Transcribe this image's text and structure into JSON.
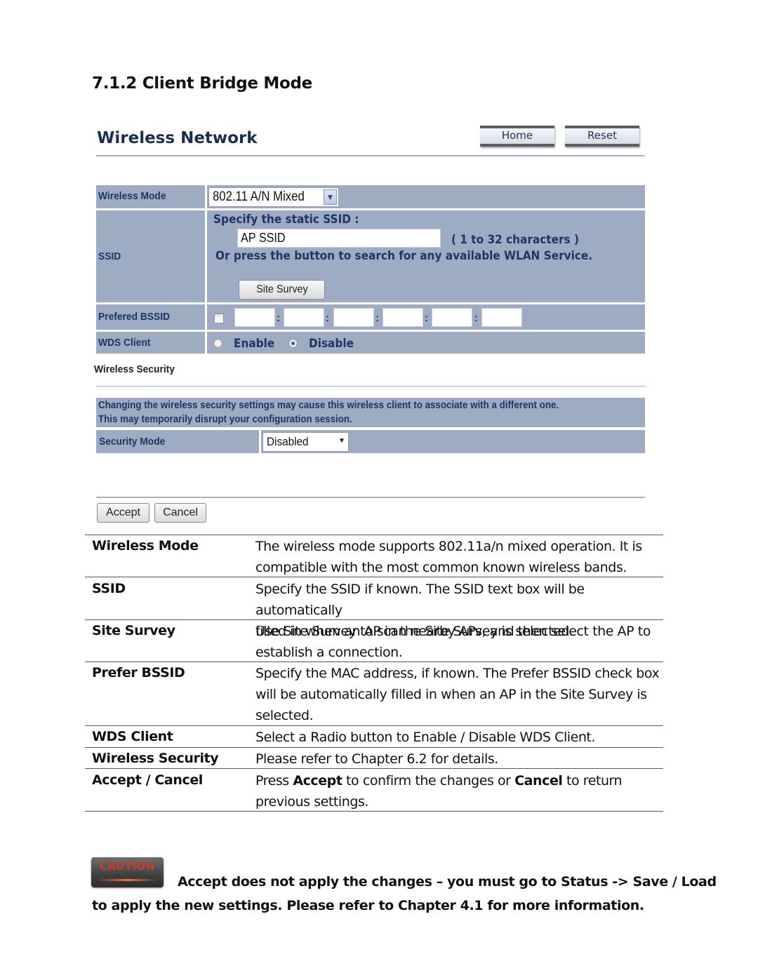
{
  "section_heading": "7.1.2 Client Bridge Mode",
  "panel": {
    "title": "Wireless Network",
    "home_button": "Home",
    "reset_button": "Reset",
    "wireless_mode": {
      "label": "Wireless Mode",
      "selected": "802.11 A/N Mixed"
    },
    "ssid": {
      "label": "SSID",
      "specify_text": "Specify the static SSID  :",
      "value": "AP SSID",
      "hint": "( 1 to 32 characters )",
      "or_text": "Or press the button to search for any available WLAN Service.",
      "site_survey_button": "Site Survey"
    },
    "preferred_bssid": {
      "label": "Prefered BSSID",
      "checked": false,
      "octets": [
        "",
        "",
        "",
        "",
        "",
        ""
      ],
      "separator": ":"
    },
    "wds_client": {
      "label": "WDS Client",
      "options": [
        "Enable",
        "Disable"
      ],
      "selected": "Disable"
    },
    "wireless_security": {
      "heading": "Wireless Security",
      "warning_line1": "Changing the wireless security settings may cause this wireless client to associate with a different one.",
      "warning_line2": "This may temporarily disrupt your configuration session.",
      "security_mode_label": "Security Mode",
      "security_mode_value": "Disabled"
    },
    "accept_button": "Accept",
    "cancel_button": "Cancel"
  },
  "descriptions": [
    {
      "key": "Wireless Mode",
      "lines": [
        "The wireless mode supports 802.11a/n mixed operation. It is",
        "compatible with the most common known wireless bands."
      ]
    },
    {
      "key": "SSID",
      "lines": [
        "Specify the SSID if known. The SSID text box will be automatically",
        "filled in when an AP in the Site Survey is selected."
      ]
    },
    {
      "key": "Site Survey",
      "lines": [
        "Use Site Survey to scan nearby APs, and then select the AP to",
        "establish a connection."
      ]
    },
    {
      "key": "Prefer BSSID",
      "lines": [
        "Specify the MAC address, if known. The Prefer BSSID check box",
        "will be automatically filled in when an AP in the Site Survey is",
        "selected."
      ]
    },
    {
      "key": "WDS Client",
      "lines": [
        "Select a Radio button to Enable / Disable WDS Client."
      ]
    },
    {
      "key": "Wireless Security",
      "lines": [
        "Please refer to Chapter 6.2 for details."
      ]
    },
    {
      "key": "Accept / Cancel",
      "line1_pre": "Press ",
      "line1_b1": "Accept",
      "line1_mid": " to confirm the changes or ",
      "line1_b2": "Cancel",
      "line1_post": " to return",
      "line2": "previous settings."
    }
  ],
  "caution": {
    "badge": "CAUTION",
    "line1": "Accept does not apply the changes – you must go to Status -> Save / Load",
    "line2": "to apply the new settings. Please refer to Chapter 4.1 for more information."
  },
  "colors": {
    "row_background": "#9dabc3",
    "label_text": "#1f3566",
    "title_text": "#1a2e52"
  }
}
